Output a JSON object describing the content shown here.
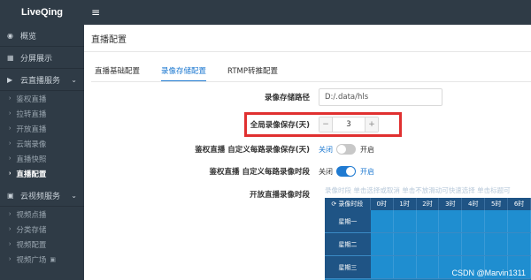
{
  "app": {
    "logo": "LiveQing",
    "menu_icon": "hamburger-icon"
  },
  "sidebar": {
    "items": [
      {
        "icon": "dashboard-icon",
        "label": "概览"
      },
      {
        "icon": "grid-icon",
        "label": "分屏展示"
      }
    ],
    "groups": [
      {
        "label": "云直播服务",
        "icon": "video-camera-icon",
        "chevron": "chevron-down-icon",
        "sub": [
          "鉴权直播",
          "拉转直播",
          "开放直播",
          "云端录像",
          "直播快照",
          "直播配置"
        ],
        "active_index": 5
      },
      {
        "label": "云视频服务",
        "icon": "film-icon",
        "chevron": "chevron-down-icon",
        "sub": [
          "视频点播",
          "分类存储",
          "视频配置",
          "视频广场"
        ]
      }
    ]
  },
  "main": {
    "title": "直播配置",
    "tabs": [
      "直播基础配置",
      "录像存储配置",
      "RTMP转推配置"
    ],
    "active_tab": 1,
    "form": {
      "storage_path_label": "录像存储路径",
      "storage_path_value": "D:/.data/hls",
      "retain_days_label": "全局录像保存(天)",
      "retain_days_value": "3",
      "retain_days_minus": "−",
      "retain_days_plus": "+",
      "auth_retain_label": "鉴权直播 自定义每路录像保存(天)",
      "auth_retain_off": "关闭",
      "auth_retain_on": "开启",
      "auth_retain_state": "off",
      "auth_period_label": "鉴权直播 自定义每路录像时段",
      "auth_period_off": "关闭",
      "auth_period_on": "开启",
      "auth_period_state": "on",
      "open_period_label": "开放直播录像时段"
    },
    "schedule": {
      "hint": "录像时段 单击选择或取消 单击不放滑动可快速选择 单击标题可",
      "corner_label": "⟳ 录像时段",
      "hours": [
        "0时",
        "1时",
        "2时",
        "3时",
        "4时",
        "5时",
        "6时"
      ],
      "days": [
        "星期一",
        "星期二",
        "星期三"
      ]
    }
  },
  "watermark": "CSDN @Marvin1311",
  "colors": {
    "accent": "#1f7ad1",
    "sidebar_bg": "#2f3b46",
    "highlight": "#e03030"
  }
}
